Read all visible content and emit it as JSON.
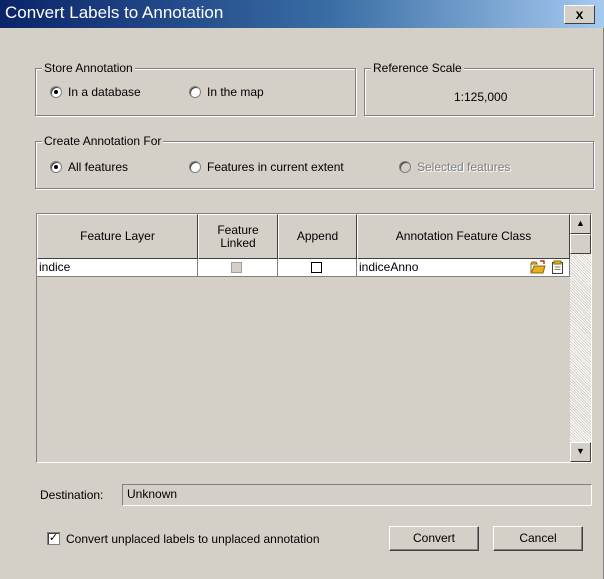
{
  "window": {
    "title": "Convert Labels to Annotation",
    "close_label": "x"
  },
  "store_annotation": {
    "legend": "Store Annotation",
    "options": [
      {
        "label": "In a database",
        "selected": true
      },
      {
        "label": "In the map",
        "selected": false
      }
    ]
  },
  "reference_scale": {
    "legend": "Reference Scale",
    "value": "1:125,000"
  },
  "create_for": {
    "legend": "Create Annotation For",
    "options": [
      {
        "label": "All features",
        "selected": true,
        "enabled": true
      },
      {
        "label": "Features in current extent",
        "selected": false,
        "enabled": true
      },
      {
        "label": "Selected features",
        "selected": false,
        "enabled": false
      }
    ]
  },
  "table": {
    "columns": [
      "Feature Layer",
      "Feature Linked",
      "Append",
      "Annotation Feature Class"
    ],
    "rows": [
      {
        "feature_layer": "indice",
        "feature_linked": false,
        "append": false,
        "annotation_class": "indiceAnno"
      }
    ]
  },
  "destination": {
    "label": "Destination:",
    "value": "Unknown"
  },
  "unplaced": {
    "label": "Convert unplaced labels to unplaced annotation",
    "checked": true
  },
  "buttons": {
    "convert": "Convert",
    "cancel": "Cancel"
  },
  "icons": {
    "open_folder": "open-folder-icon",
    "properties": "properties-icon",
    "up": "scroll-up-arrow-icon",
    "down": "scroll-down-arrow-icon"
  }
}
